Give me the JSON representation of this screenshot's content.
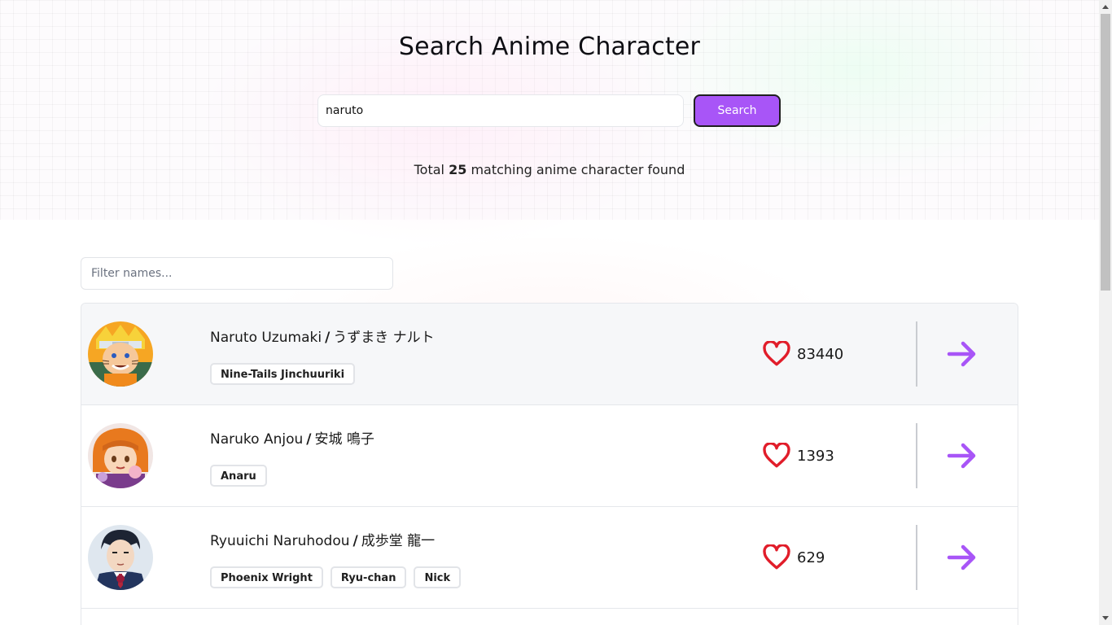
{
  "header": {
    "title": "Search Anime Character"
  },
  "search": {
    "value": "naruto",
    "button_label": "Search"
  },
  "results": {
    "prefix": "Total",
    "count": "25",
    "suffix": "matching anime character found"
  },
  "filter": {
    "placeholder": "Filter names..."
  },
  "characters": [
    {
      "name": "Naruto Uzumaki",
      "separator": "/",
      "native_name": "うずまき ナルト",
      "tags": [
        "Nine-Tails Jinchuuriki"
      ],
      "favorites": "83440"
    },
    {
      "name": "Naruko Anjou",
      "separator": "/",
      "native_name": "安城 鳴子",
      "tags": [
        "Anaru"
      ],
      "favorites": "1393"
    },
    {
      "name": "Ryuuichi Naruhodou",
      "separator": "/",
      "native_name": "成歩堂 龍一",
      "tags": [
        "Phoenix Wright",
        "Ryu-chan",
        "Nick"
      ],
      "favorites": "629"
    }
  ],
  "icons": {
    "favorite": "heart-icon",
    "open": "arrow-right-icon"
  },
  "colors": {
    "accent": "#a855f7",
    "heart": "#e11d2a"
  }
}
